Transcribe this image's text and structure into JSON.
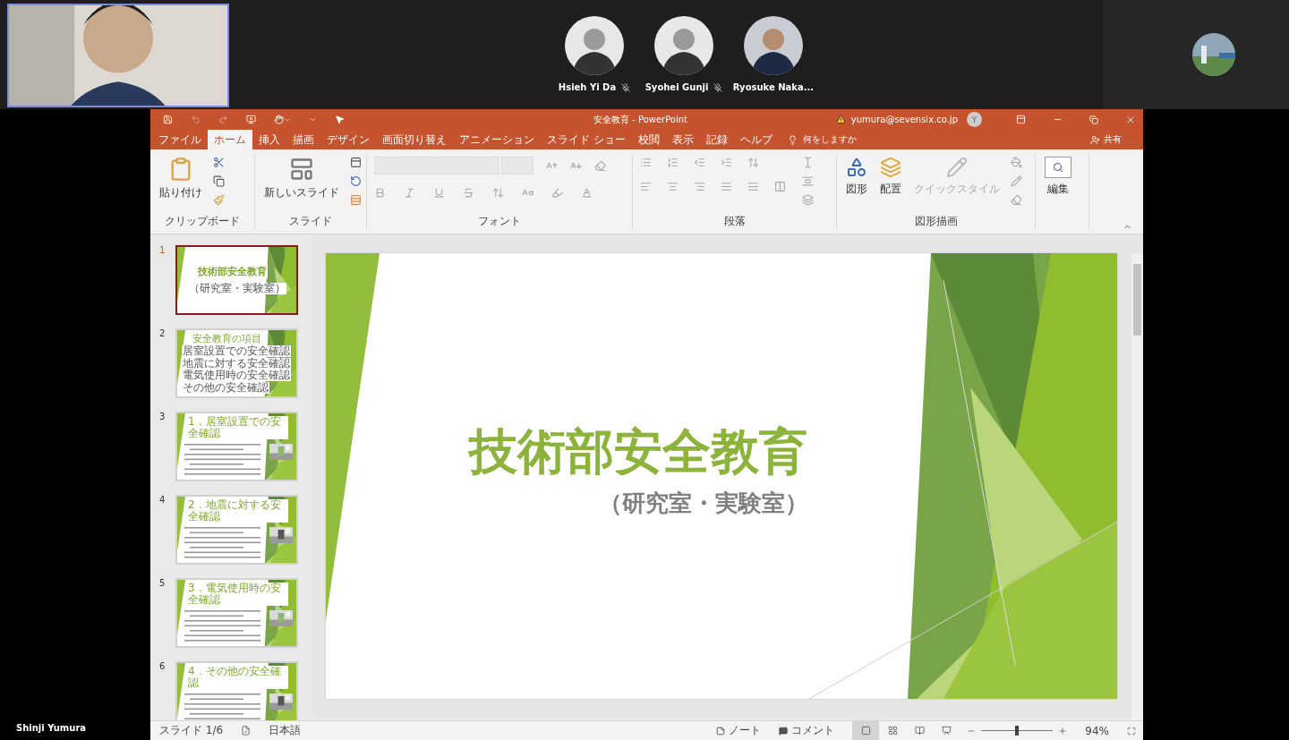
{
  "meeting": {
    "presenter": {
      "kind": "picture",
      "name": "Shinji Yumura"
    },
    "participants": [
      {
        "name": "Hsieh Yi Da",
        "muted": true
      },
      {
        "name": "Syohei Gunji",
        "muted": true
      },
      {
        "name": "Ryosuke Naka...",
        "muted": false
      }
    ]
  },
  "window": {
    "title": "安全教育 - PowerPoint",
    "account": "yumura@sevensix.co.jp",
    "avatar_initial": "Y"
  },
  "tabs": [
    {
      "label": "ファイル",
      "selected": false
    },
    {
      "label": "ホーム",
      "selected": true
    },
    {
      "label": "挿入",
      "selected": false
    },
    {
      "label": "描画",
      "selected": false
    },
    {
      "label": "デザイン",
      "selected": false
    },
    {
      "label": "画面切り替え",
      "selected": false
    },
    {
      "label": "アニメーション",
      "selected": false
    },
    {
      "label": "スライド ショー",
      "selected": false
    },
    {
      "label": "校閲",
      "selected": false
    },
    {
      "label": "表示",
      "selected": false
    },
    {
      "label": "記録",
      "selected": false
    },
    {
      "label": "ヘルプ",
      "selected": false
    }
  ],
  "tell_me": "何をしますか",
  "share": "共有",
  "ribbon": [
    {
      "kind": "clipboard",
      "label": "クリップボード",
      "buttons": [
        "貼り付け"
      ]
    },
    {
      "kind": "slides",
      "label": "スライド",
      "buttons": [
        "新しいスライド"
      ]
    },
    {
      "kind": "font",
      "label": "フォント"
    },
    {
      "kind": "paragraph",
      "label": "段落"
    },
    {
      "kind": "drawing",
      "label": "図形描画",
      "buttons": [
        "図形",
        "配置",
        "クイックスタイル"
      ]
    },
    {
      "kind": "editing",
      "buttons": [
        "編集"
      ]
    }
  ],
  "thumbnails": [
    {
      "number": "1",
      "kind": "title",
      "selected": true,
      "title": "技術部安全教育",
      "subtitle": "（研究室・実験室）"
    },
    {
      "number": "2",
      "kind": "list",
      "selected": false,
      "title": "安全教育の項目",
      "items": [
        "居室設置での安全確認",
        "地震に対する安全確認",
        "電気使用時の安全確認",
        "その他の安全確認"
      ]
    },
    {
      "number": "3",
      "kind": "content",
      "selected": false,
      "title": "1．居室設置での安全確認"
    },
    {
      "number": "4",
      "kind": "content",
      "selected": false,
      "title": "2．地震に対する安全確認"
    },
    {
      "number": "5",
      "kind": "content",
      "selected": false,
      "title": "3．電気使用時の安全確認"
    },
    {
      "number": "6",
      "kind": "content",
      "selected": false,
      "title": "4．その他の安全確認"
    }
  ],
  "slide": {
    "title": "技術部安全教育",
    "subtitle": "（研究室・実験室）"
  },
  "status_bar": {
    "slide": "スライド 1/6",
    "language": "日本語",
    "notes": "ノート",
    "comments": "コメント",
    "views": [
      {
        "kind": "normal",
        "selected": true
      },
      {
        "kind": "sorter",
        "selected": false
      },
      {
        "kind": "reading",
        "selected": false
      },
      {
        "kind": "show",
        "selected": false
      }
    ],
    "zoom": {
      "level": 0.5,
      "reading": "94%"
    }
  }
}
